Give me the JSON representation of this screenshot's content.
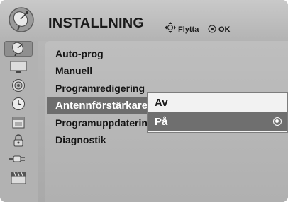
{
  "header": {
    "title": "INSTALLNING",
    "hints": {
      "move_label": "Flytta",
      "ok_label": "OK"
    },
    "logo_icon": "satellite-dish-icon"
  },
  "sidebar": {
    "items": [
      {
        "icon": "satellite-dish-icon",
        "active": true
      },
      {
        "icon": "monitor-icon",
        "active": false
      },
      {
        "icon": "speaker-icon",
        "active": false
      },
      {
        "icon": "clock-icon",
        "active": false
      },
      {
        "icon": "calendar-icon",
        "active": false
      },
      {
        "icon": "padlock-icon",
        "active": false
      },
      {
        "icon": "connector-icon",
        "active": false
      },
      {
        "icon": "clapperboard-icon",
        "active": false
      }
    ]
  },
  "menu": {
    "items": [
      {
        "label": "Auto-prog"
      },
      {
        "label": "Manuell"
      },
      {
        "label": "Programredigering"
      },
      {
        "label": "Antennförstärkare"
      },
      {
        "label": "Programuppdatering"
      },
      {
        "label": "Diagnostik"
      }
    ],
    "selected_index": 3
  },
  "popup": {
    "options": [
      {
        "label": "Av",
        "selected": false
      },
      {
        "label": "På",
        "selected": true
      }
    ]
  },
  "colors": {
    "highlight": "#6d6d6d",
    "popup_bg": "#f2f2f2",
    "background": "#b2b2b2"
  }
}
